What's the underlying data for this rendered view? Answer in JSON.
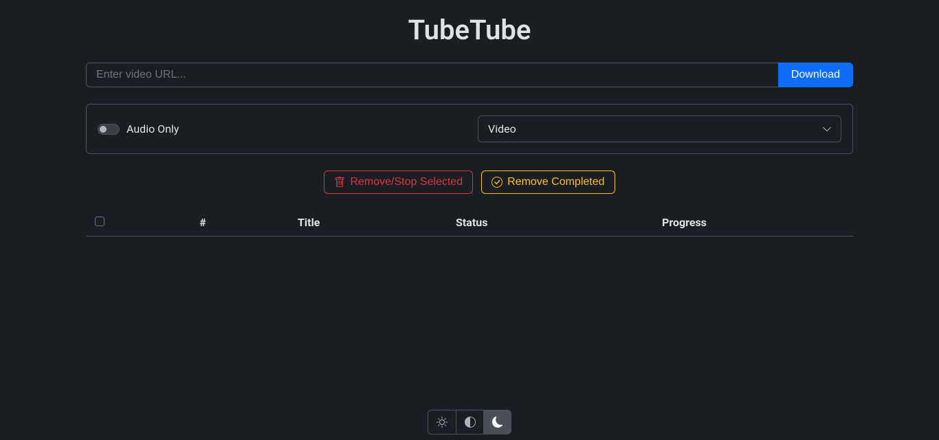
{
  "app": {
    "title": "TubeTube"
  },
  "input": {
    "url_placeholder": "Enter video URL...",
    "download_label": "Download"
  },
  "options": {
    "audio_only_label": "Audio Only",
    "format_selected": "Video"
  },
  "actions": {
    "remove_selected_label": "Remove/Stop Selected",
    "remove_completed_label": "Remove Completed"
  },
  "table": {
    "headers": {
      "num": "#",
      "title": "Title",
      "status": "Status",
      "progress": "Progress"
    }
  }
}
